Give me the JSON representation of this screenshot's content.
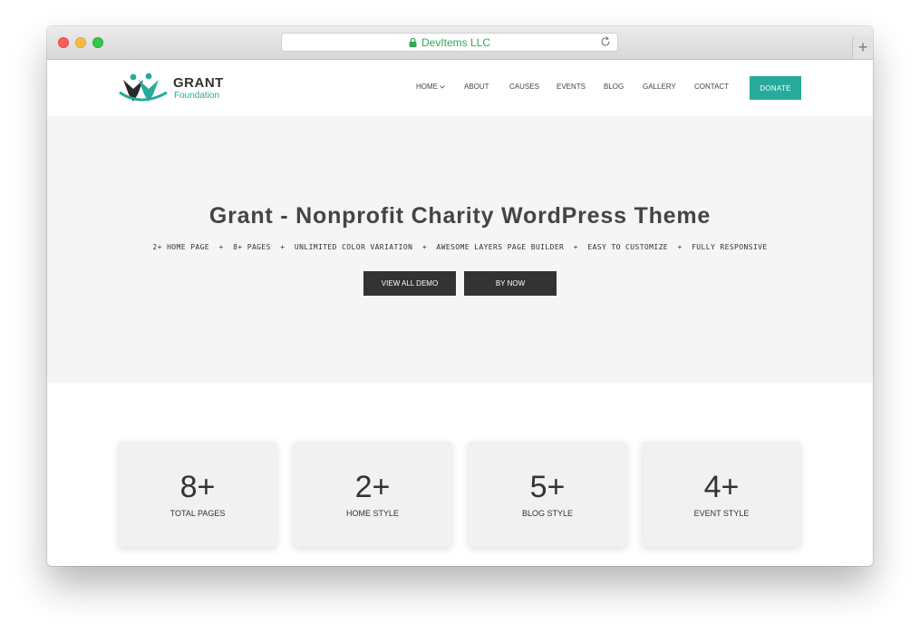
{
  "browser": {
    "url_text": "DevItems LLC",
    "new_tab_symbol": "+"
  },
  "site": {
    "logo": {
      "name": "GRANT",
      "tagline": "Foundation"
    },
    "nav": [
      "HOME",
      "ABOUT",
      "CAUSES",
      "EVENTS",
      "BLOG",
      "GALLERY",
      "CONTACT"
    ],
    "donate_label": "DONATE"
  },
  "hero": {
    "title": "Grant - Nonprofit Charity WordPress Theme",
    "subtitle": "2+ HOME PAGE  +  8+ PAGES  +  UNLIMITED COLOR VARIATION  +  AWESOME LAYERS PAGE BUILDER  +  EASY TO CUSTOMIZE  +  FULLY RESPONSIVE",
    "view_all_demo": "VIEW ALL DEMO",
    "by_now": "BY NOW"
  },
  "stats": [
    {
      "value": "8+",
      "label": "TOTAL PAGES"
    },
    {
      "value": "2+",
      "label": "HOME STYLE"
    },
    {
      "value": "5+",
      "label": "BLOG STYLE"
    },
    {
      "value": "4+",
      "label": "EVENT STYLE"
    }
  ],
  "colors": {
    "accent": "#26aa9b",
    "dark_button": "#333333",
    "hero_bg": "#f5f5f5"
  }
}
